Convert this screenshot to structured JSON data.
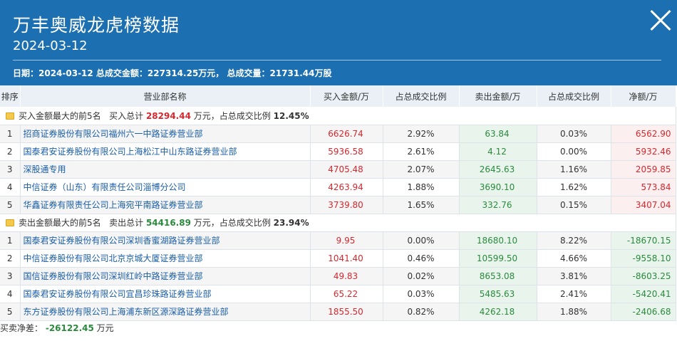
{
  "header": {
    "title": "万丰奥威龙虎榜数据",
    "date": "2024-03-12",
    "summary": "日期：2024-03-12 总成交金额：227314.25万元， 总成交量：21731.44万股"
  },
  "columns": [
    "排序",
    "营业部名称",
    "买入金额/万",
    "占总成交比例",
    "卖出金额/万",
    "占总成交比例",
    "净额/万"
  ],
  "buy_section": {
    "label": "买入金额最大的前5名",
    "total_prefix": "买入总计",
    "total": "28294.44",
    "unit_text": "万元，占总成交比例",
    "ratio": "12.45%",
    "rows": [
      {
        "rank": "1",
        "name": "招商证券股份有限公司福州六一中路证券营业部",
        "buy": "6626.74",
        "buy_ratio": "2.92%",
        "sell": "63.84",
        "sell_ratio": "0.03%",
        "net": "6562.90"
      },
      {
        "rank": "2",
        "name": "国泰君安证券股份有限公司上海松江中山东路证券营业部",
        "buy": "5936.58",
        "buy_ratio": "2.61%",
        "sell": "4.12",
        "sell_ratio": "0.00%",
        "net": "5932.46"
      },
      {
        "rank": "3",
        "name": "深股通专用",
        "buy": "4705.48",
        "buy_ratio": "2.07%",
        "sell": "2645.63",
        "sell_ratio": "1.16%",
        "net": "2059.85"
      },
      {
        "rank": "4",
        "name": "中信证券（山东）有限责任公司淄博分公司",
        "buy": "4263.94",
        "buy_ratio": "1.88%",
        "sell": "3690.10",
        "sell_ratio": "1.62%",
        "net": "573.84"
      },
      {
        "rank": "5",
        "name": "华鑫证券有限责任公司上海宛平南路证券营业部",
        "buy": "3739.80",
        "buy_ratio": "1.65%",
        "sell": "332.76",
        "sell_ratio": "0.15%",
        "net": "3407.04"
      }
    ]
  },
  "sell_section": {
    "label": "卖出金额最大的前5名",
    "total_prefix": "卖出总计",
    "total": "54416.89",
    "unit_text": "万元，占总成交比例",
    "ratio": "23.94%",
    "rows": [
      {
        "rank": "1",
        "name": "国泰君安证券股份有限公司深圳香蜜湖路证券营业部",
        "buy": "9.95",
        "buy_ratio": "0.00%",
        "sell": "18680.10",
        "sell_ratio": "8.22%",
        "net": "-18670.15"
      },
      {
        "rank": "2",
        "name": "中信证券股份有限公司北京京城大厦证券营业部",
        "buy": "1041.40",
        "buy_ratio": "0.46%",
        "sell": "10599.50",
        "sell_ratio": "4.66%",
        "net": "-9558.10"
      },
      {
        "rank": "3",
        "name": "国信证券股份有限公司深圳红岭中路证券营业部",
        "buy": "49.83",
        "buy_ratio": "0.02%",
        "sell": "8653.08",
        "sell_ratio": "3.81%",
        "net": "-8603.25"
      },
      {
        "rank": "4",
        "name": "国泰君安证券股份有限公司宜昌珍珠路证券营业部",
        "buy": "65.22",
        "buy_ratio": "0.03%",
        "sell": "5485.63",
        "sell_ratio": "2.41%",
        "net": "-5420.41"
      },
      {
        "rank": "5",
        "name": "东方证券股份有限公司上海浦东新区源深路证券营业部",
        "buy": "1855.50",
        "buy_ratio": "0.82%",
        "sell": "4262.18",
        "sell_ratio": "1.88%",
        "net": "-2406.68"
      }
    ]
  },
  "footer": {
    "label": "买卖净差：",
    "value": "-26122.45",
    "unit": "万元"
  },
  "icons": {
    "section_icon": "folder-icon",
    "close_icon": "close-icon"
  },
  "colors": {
    "header_bg": "#1c6fb0",
    "buy_red": "#d6282f",
    "sell_green": "#2b8a3e",
    "link_blue": "#1a5ea8"
  }
}
